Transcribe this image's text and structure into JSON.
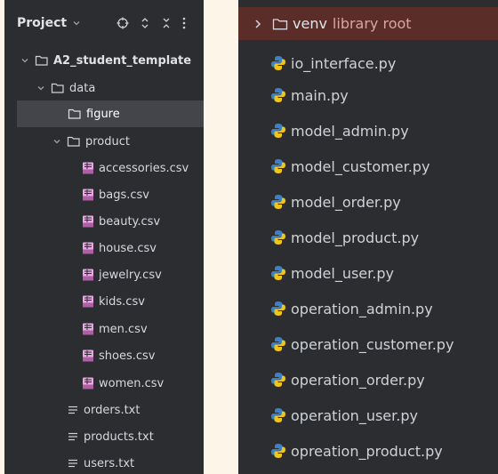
{
  "left_panel": {
    "header": {
      "title": "Project",
      "actions": [
        "target-icon",
        "expand-collapse-icon",
        "collapse-icon",
        "more-icon"
      ]
    },
    "tree": {
      "root": "A2_student_template",
      "data_folder": "data",
      "figure_folder": "figure",
      "product_folder": "product",
      "csv_files": [
        "accessories.csv",
        "bags.csv",
        "beauty.csv",
        "house.csv",
        "jewelry.csv",
        "kids.csv",
        "men.csv",
        "shoes.csv",
        "women.csv"
      ],
      "txt_files": [
        "orders.txt",
        "products.txt",
        "users.txt"
      ]
    }
  },
  "right_panel": {
    "venv": {
      "name": "venv",
      "suffix": "library root"
    },
    "py_files": [
      "io_interface.py",
      "main.py",
      "model_admin.py",
      "model_customer.py",
      "model_order.py",
      "model_product.py",
      "model_user.py",
      "operation_admin.py",
      "operation_customer.py",
      "operation_order.py",
      "operation_user.py",
      "opreation_product.py"
    ]
  },
  "colors": {
    "panel_bg": "#2b2d30",
    "page_bg": "#fdf6e8",
    "selected_row": "#43454a",
    "venv_highlight": "#5a2d28",
    "python_blue": "#3b82c4",
    "python_yellow": "#f0c419",
    "csv_icon": "#e6a8e0"
  }
}
